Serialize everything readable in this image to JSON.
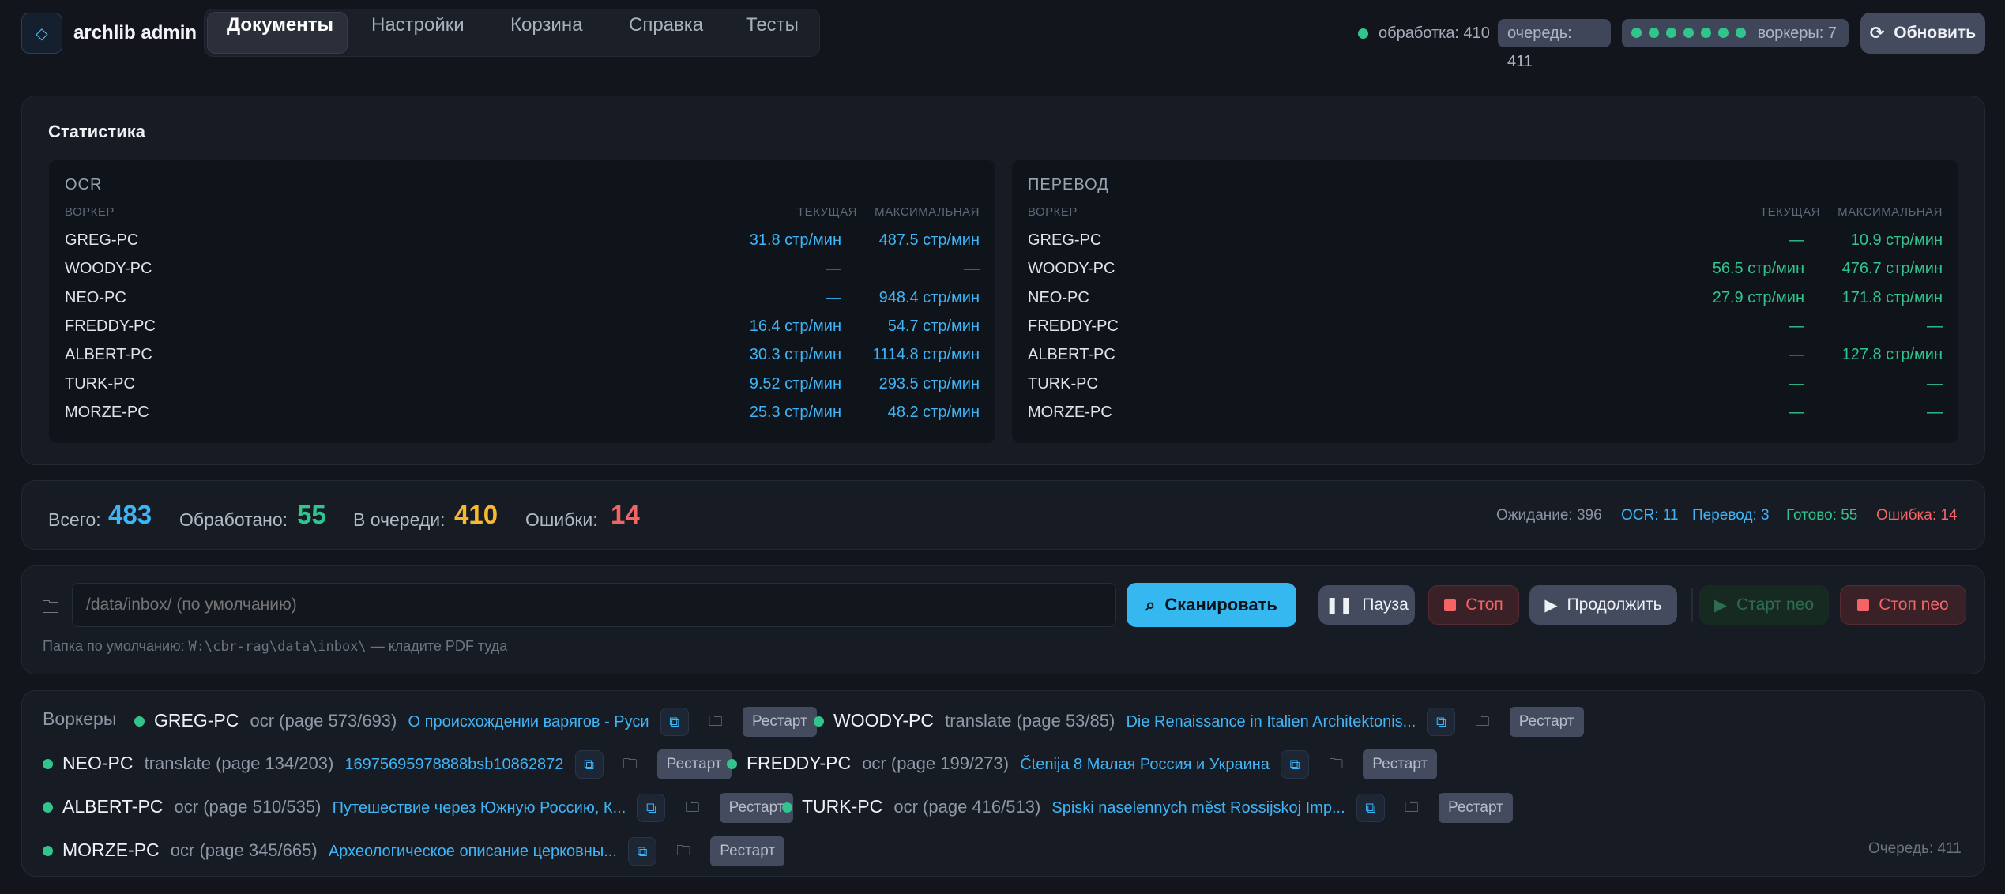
{
  "header": {
    "logo_glyph": "◇",
    "title": "archlib admin",
    "tabs": [
      {
        "label": "Документы",
        "active": true
      },
      {
        "label": "Настройки"
      },
      {
        "label": "Корзина"
      },
      {
        "label": "Справка"
      },
      {
        "label": "Тесты"
      }
    ],
    "processing": "обработка: 410",
    "queue": "очередь: 411",
    "workers_count": "воркеры: 7",
    "worker_dots": 7,
    "refresh": "Обновить"
  },
  "stats": {
    "title": "Статистика",
    "col_worker": "ВОРКЕР",
    "col_current": "ТЕКУЩАЯ",
    "col_max": "МАКСИМАЛЬНАЯ",
    "ocr": {
      "title": "OCR",
      "rows": [
        {
          "name": "GREG-PC",
          "current": "31.8 стр/мин",
          "max": "487.5 стр/мин"
        },
        {
          "name": "WOODY-PC",
          "current": "—",
          "max": "—"
        },
        {
          "name": "NEO-PC",
          "current": "—",
          "max": "948.4 стр/мин"
        },
        {
          "name": "FREDDY-PC",
          "current": "16.4 стр/мин",
          "max": "54.7 стр/мин"
        },
        {
          "name": "ALBERT-PC",
          "current": "30.3 стр/мин",
          "max": "1114.8 стр/мин"
        },
        {
          "name": "TURK-PC",
          "current": "9.52 стр/мин",
          "max": "293.5 стр/мин"
        },
        {
          "name": "MORZE-PC",
          "current": "25.3 стр/мин",
          "max": "48.2 стр/мин"
        }
      ]
    },
    "translate": {
      "title": "ПЕРЕВОД",
      "rows": [
        {
          "name": "GREG-PC",
          "current": "—",
          "max": "10.9 стр/мин"
        },
        {
          "name": "WOODY-PC",
          "current": "56.5 стр/мин",
          "max": "476.7 стр/мин"
        },
        {
          "name": "NEO-PC",
          "current": "27.9 стр/мин",
          "max": "171.8 стр/мин"
        },
        {
          "name": "FREDDY-PC",
          "current": "—",
          "max": "—"
        },
        {
          "name": "ALBERT-PC",
          "current": "—",
          "max": "127.8 стр/мин"
        },
        {
          "name": "TURK-PC",
          "current": "—",
          "max": "—"
        },
        {
          "name": "MORZE-PC",
          "current": "—",
          "max": "—"
        }
      ]
    }
  },
  "totals": {
    "total_label": "Всего:",
    "total": "483",
    "done_label": "Обработано:",
    "done": "55",
    "queue_label": "В очереди:",
    "queue": "410",
    "errors_label": "Ошибки:",
    "errors": "14",
    "waiting": "Ожидание: 396",
    "ocr": "OCR: 11",
    "translate": "Перевод: 3",
    "ready": "Готово: 55",
    "error": "Ошибка: 14"
  },
  "scan": {
    "placeholder": "/data/inbox/ (по умолчанию)",
    "scan": "Сканировать",
    "pause": "Пауза",
    "stop": "Стоп",
    "resume": "Продолжить",
    "start_neo": "Старт neo",
    "stop_neo": "Стоп neo",
    "hint_pre": "Папка по умолчанию: ",
    "hint_path": "W:\\cbr-rag\\data\\inbox\\",
    "hint_post": " — кладите PDF туда"
  },
  "workers": {
    "title": "Воркеры",
    "restart": "Рестарт",
    "queue": "Очередь: 411",
    "items": [
      {
        "name": "GREG-PC",
        "status": "ocr (page 573/693)",
        "doc": "О происхождении варягов - Руси"
      },
      {
        "name": "WOODY-PC",
        "status": "translate (page 53/85)",
        "doc": "Die Renaissance in Italien Architektonis..."
      },
      {
        "name": "NEO-PC",
        "status": "translate (page 134/203)",
        "doc": "16975695978888bsb10862872"
      },
      {
        "name": "FREDDY-PC",
        "status": "ocr (page 199/273)",
        "doc": "Čtenija 8 Малая Россия и Украина"
      },
      {
        "name": "ALBERT-PC",
        "status": "ocr (page 510/535)",
        "doc": "Путешествие через Южную Россию, К..."
      },
      {
        "name": "TURK-PC",
        "status": "ocr (page 416/513)",
        "doc": "Spiski naselennych mĕst Rossijskoj Imp..."
      },
      {
        "name": "MORZE-PC",
        "status": "ocr (page 345/665)",
        "doc": "Археологическое описание церковны..."
      }
    ]
  }
}
